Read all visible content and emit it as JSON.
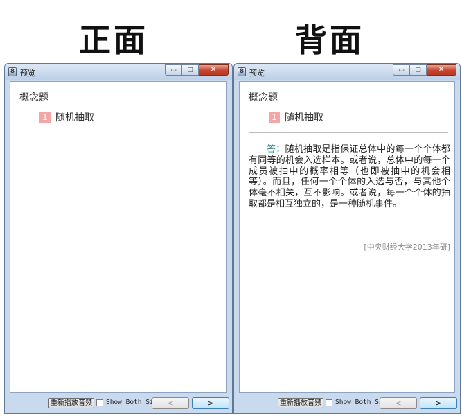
{
  "headings": {
    "front": "正面",
    "back": "背面"
  },
  "window": {
    "title": "预览",
    "app_icon_glyph": "8",
    "minimize_glyph": "▭",
    "maximize_glyph": "□",
    "close_glyph": "✕"
  },
  "card": {
    "category": "概念题",
    "question_number": "1",
    "question": "随机抽取",
    "answer_label": "答：",
    "answer_text": "随机抽取是指保证总体中的每一个个体都有同等的机会入选样本。或者说，总体中的每一个成员被抽中的概率相等（也即被抽中的机会相等）。而且，任何一个个体的入选与否，与其他个体毫不相关，互不影响。或者说，每一个个体的抽取都是相互独立的，是一种随机事件。",
    "source": "[中央财经大学2013年研]"
  },
  "controls": {
    "replay_label": "重新播放音频",
    "show_both_sides_label": "Show Both Sides",
    "show_both_sides_checked": false,
    "prev_glyph": "<",
    "next_glyph": ">"
  },
  "colors": {
    "question_badge": "#f4a5a5",
    "answer_label": "#2d8f8a",
    "window_frame": "#c9d9ee",
    "close_button": "#c6442c"
  }
}
